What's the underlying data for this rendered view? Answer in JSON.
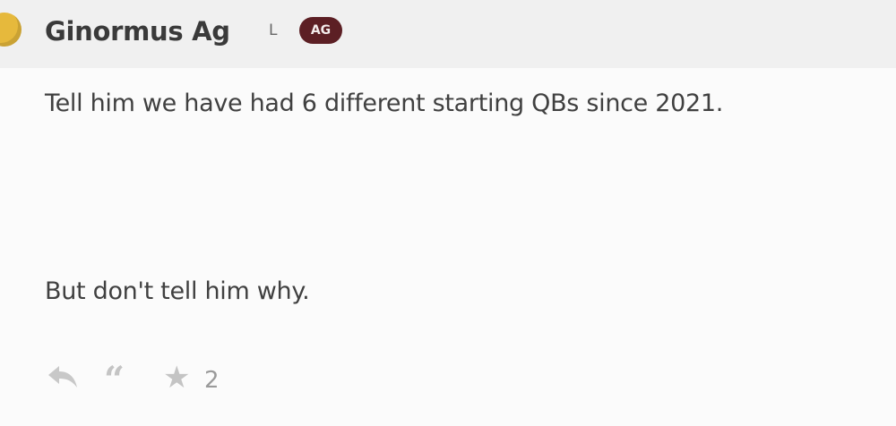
{
  "post": {
    "author": "Ginormus Ag",
    "level": "L",
    "badge": "AG",
    "lines": [
      "Tell him we have had 6 different starting QBs since 2021.",
      "But don't tell him why."
    ],
    "actions": {
      "reply_icon": "reply-icon",
      "quote_icon": "quote-icon",
      "star_icon": "star-icon",
      "star_count": "2"
    }
  },
  "colors": {
    "header_bg": "#f0f0f0",
    "badge_bg": "#5c1f24",
    "avatar": "#e6b93c"
  }
}
